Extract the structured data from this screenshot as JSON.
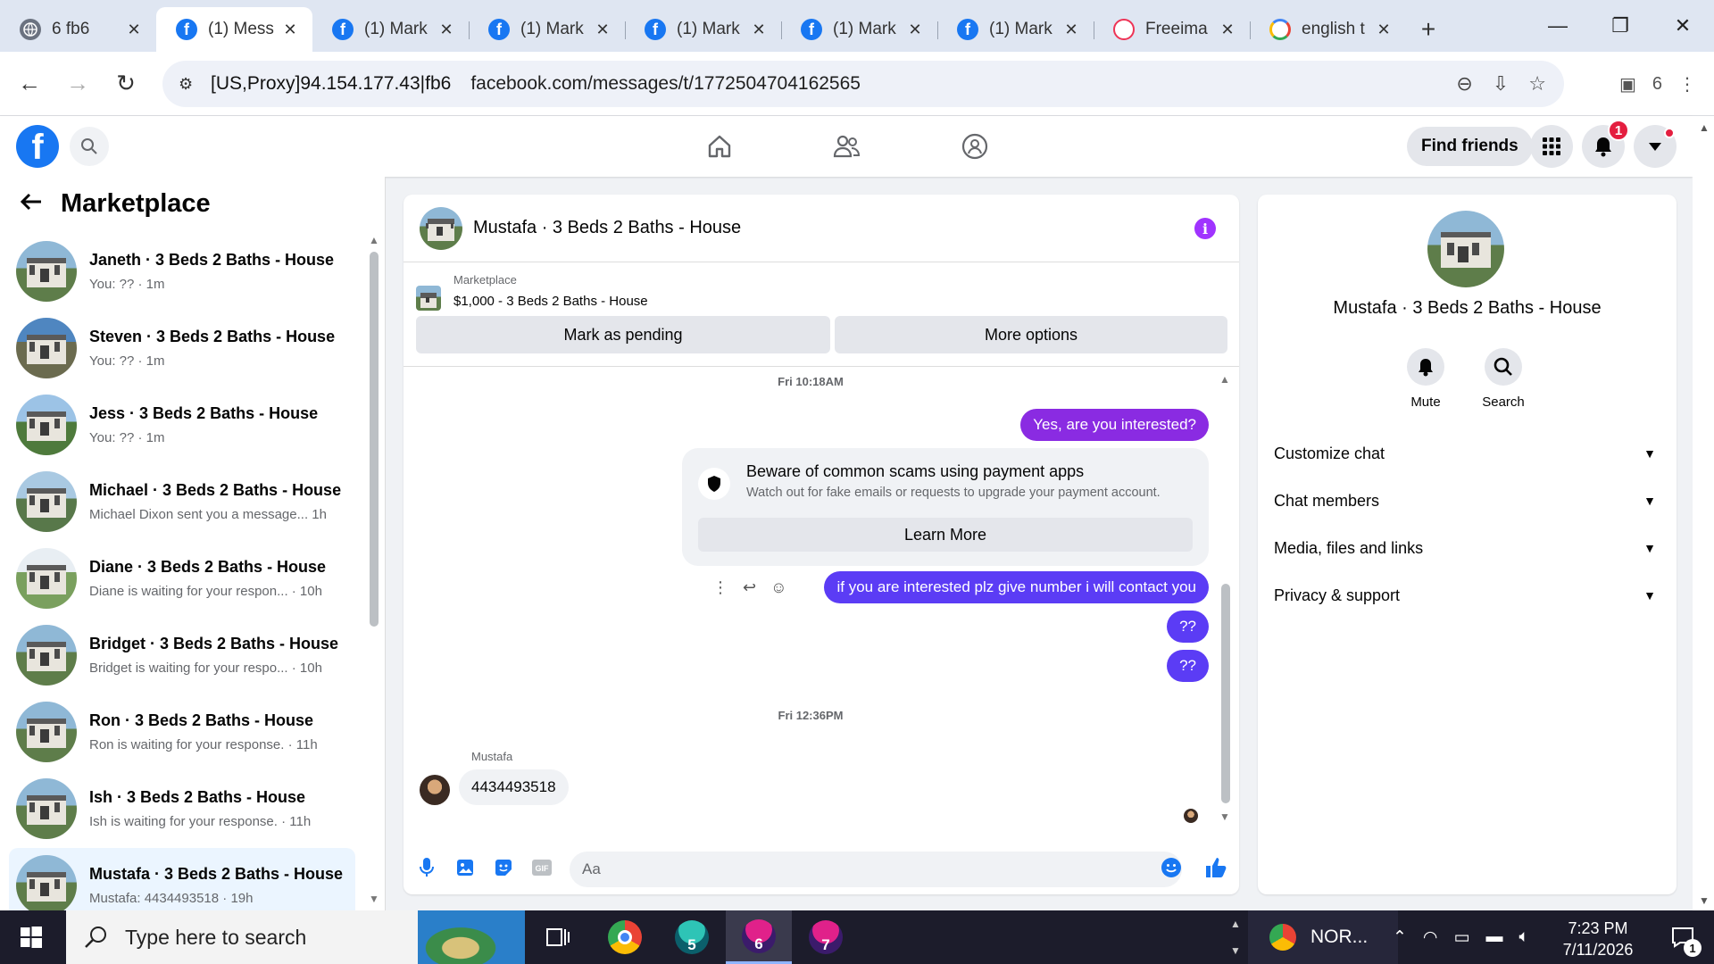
{
  "browser": {
    "tabs": [
      {
        "title": "6 fb6",
        "icon": "globe-icon",
        "active": false
      },
      {
        "title": "(1) Mess",
        "icon": "facebook-icon",
        "active": true
      },
      {
        "title": "(1) Mark",
        "icon": "facebook-icon",
        "active": false
      },
      {
        "title": "(1) Mark",
        "icon": "facebook-icon",
        "active": false
      },
      {
        "title": "(1) Mark",
        "icon": "facebook-icon",
        "active": false
      },
      {
        "title": "(1) Mark",
        "icon": "facebook-icon",
        "active": false
      },
      {
        "title": "(1) Mark",
        "icon": "facebook-icon",
        "active": false
      },
      {
        "title": "Freeima",
        "icon": "freeimages-icon",
        "active": false
      },
      {
        "title": "english t",
        "icon": "google-icon",
        "active": false
      }
    ],
    "new_tab": "+",
    "proxy_label": "[US,Proxy]94.154.177.43|fb6",
    "url": "facebook.com/messages/t/1772504704162565",
    "profile_number": "6"
  },
  "facebook": {
    "find_friends": "Find friends",
    "notification_count": "1"
  },
  "sidebar": {
    "title": "Marketplace",
    "conversations": [
      {
        "name": "Janeth · 3 Beds 2 Baths - House",
        "snippet": "You: ?? · 1m"
      },
      {
        "name": "Steven · 3 Beds 2 Baths - House",
        "snippet": "You: ?? · 1m"
      },
      {
        "name": "Jess · 3 Beds 2 Baths - House",
        "snippet": "You: ?? · 1m"
      },
      {
        "name": "Michael · 3 Beds 2 Baths - House",
        "snippet": "Michael Dixon sent you a message... 1h"
      },
      {
        "name": "Diane · 3 Beds 2 Baths - House",
        "snippet": "Diane is waiting for your respon...  · 10h"
      },
      {
        "name": "Bridget · 3 Beds 2 Baths - House",
        "snippet": "Bridget is waiting for your respo... · 10h"
      },
      {
        "name": "Ron · 3 Beds 2 Baths - House",
        "snippet": "Ron is waiting for your response. · 11h"
      },
      {
        "name": "Ish · 3 Beds 2 Baths - House",
        "snippet": "Ish is waiting for your response. · 11h"
      },
      {
        "name": "Mustafa · 3 Beds 2 Baths - House",
        "snippet": "Mustafa: 4434493518 · 19h"
      }
    ]
  },
  "chat": {
    "title": "Mustafa · 3 Beds 2 Baths - House",
    "listing_category": "Marketplace",
    "listing_price_title": "$1,000 - 3 Beds 2 Baths - House",
    "mark_pending": "Mark as pending",
    "more_options": "More options",
    "timestamp_1": "Fri 10:18AM",
    "msg_1": "Yes, are you interested?",
    "scam_title": "Beware of common scams using payment apps",
    "scam_sub": "Watch out for fake emails or requests to upgrade your payment account.",
    "learn_more": "Learn More",
    "msg_2": "if you are interested plz give number i will contact you",
    "msg_3": "??",
    "msg_4": "??",
    "timestamp_2": "Fri 12:36PM",
    "sender": "Mustafa",
    "msg_in": "4434493518",
    "composer_placeholder": "Aa"
  },
  "info_panel": {
    "name": "Mustafa · 3 Beds 2 Baths - House",
    "mute": "Mute",
    "search": "Search",
    "rows": [
      "Customize chat",
      "Chat members",
      "Media, files and links",
      "Privacy & support"
    ]
  },
  "taskbar": {
    "search_placeholder": "Type here to search",
    "app_5": "5",
    "app_6": "6",
    "app_7": "7",
    "vpn_label": "NOR...",
    "time": "7:23 PM",
    "date": "7/11/2026",
    "notification_count": "1"
  },
  "colors": {
    "facebook_blue": "#1877f2",
    "outgoing_purple": "#8a2be2",
    "outgoing_blue": "#5b3cf5",
    "info_purple": "#a033ff"
  }
}
